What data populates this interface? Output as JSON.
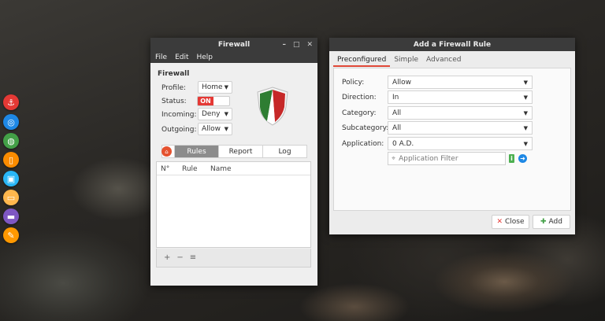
{
  "dock": {
    "items": [
      {
        "icon": "anchor-icon",
        "color": "#e53935",
        "glyph": "⚓"
      },
      {
        "icon": "browser-icon",
        "color": "#1e88e5",
        "glyph": "◎"
      },
      {
        "icon": "globe-icon",
        "color": "#43a047",
        "glyph": "◍"
      },
      {
        "icon": "phone-icon",
        "color": "#fb8c00",
        "glyph": "▯"
      },
      {
        "icon": "window-icon",
        "color": "#29b6f6",
        "glyph": "▣"
      },
      {
        "icon": "files-icon",
        "color": "#ffb74d",
        "glyph": "▭"
      },
      {
        "icon": "folder-icon",
        "color": "#7e57c2",
        "glyph": "▬"
      },
      {
        "icon": "edit-icon",
        "color": "#ff9800",
        "glyph": "✎"
      }
    ]
  },
  "firewall": {
    "title": "Firewall",
    "controls": {
      "minimize": "–",
      "maximize": "□",
      "close": "✕"
    },
    "menu": [
      "File",
      "Edit",
      "Help"
    ],
    "heading": "Firewall",
    "profile": {
      "label": "Profile:",
      "value": "Home"
    },
    "status": {
      "label": "Status:",
      "value": "ON",
      "color": "#e53935"
    },
    "incoming": {
      "label": "Incoming:",
      "value": "Deny"
    },
    "outgoing": {
      "label": "Outgoing:",
      "value": "Allow"
    },
    "tabs": [
      "Rules",
      "Report",
      "Log"
    ],
    "active_tab": "Rules",
    "table_headers": {
      "num": "N°",
      "rule": "Rule",
      "name": "Name"
    },
    "footer_buttons": {
      "add": "+",
      "remove": "−",
      "list": "≡"
    }
  },
  "add_rule": {
    "title": "Add a Firewall Rule",
    "tabs": [
      "Preconfigured",
      "Simple",
      "Advanced"
    ],
    "active_tab": "Preconfigured",
    "accent": "#e04838",
    "policy": {
      "label": "Policy:",
      "value": "Allow"
    },
    "direction": {
      "label": "Direction:",
      "value": "In"
    },
    "category": {
      "label": "Category:",
      "value": "All"
    },
    "subcategory": {
      "label": "Subcategory:",
      "value": "All"
    },
    "application": {
      "label": "Application:",
      "value": "0 A.D."
    },
    "filter_placeholder": "Application Filter",
    "close_label": "Close",
    "add_label": "Add"
  }
}
